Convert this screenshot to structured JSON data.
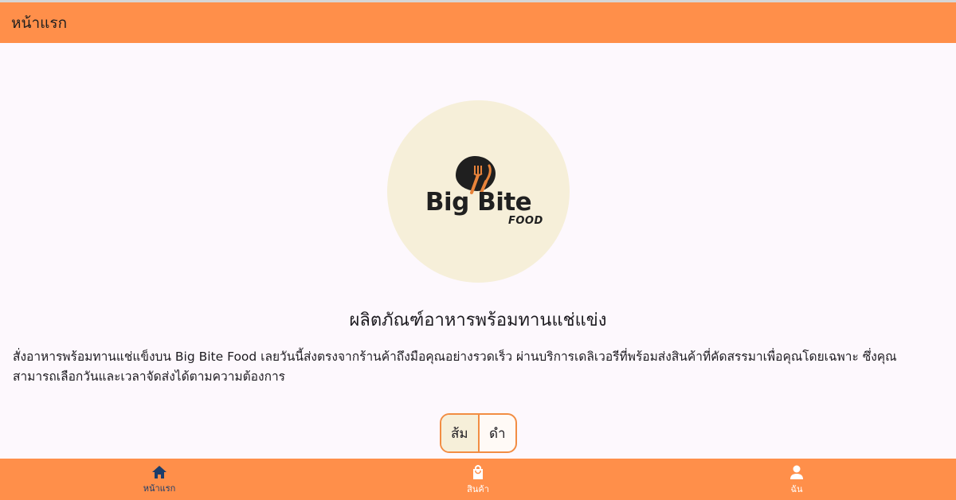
{
  "appbar": {
    "title": "หน้าแรก"
  },
  "logo": {
    "brand": "Big Bite",
    "sub": "FOOD",
    "circle_color": "#f6efd9"
  },
  "content": {
    "headline": "ผลิตภัณฑ์อาหารพร้อมทานแช่แข่ง",
    "description": "  สั่งอาหารพร้อมทานแช่แข็งบน Big Bite Food เลยวันนี้ส่งตรงจากร้านค้าถึงมือคุณอย่างรวดเร็ว ผ่านบริการเดลิเวอรีที่พร้อมส่งสินค้าที่คัดสรรมาเพื่อคุณโดยเฉพาะ ซึ่งคุณสามารถเลือกวันและเวลาจัดส่งได้ตามความต้องการ"
  },
  "theme_toggle": {
    "options": [
      "ส้ม",
      "ดำ"
    ],
    "selected": "ส้ม"
  },
  "bottom_nav": {
    "items": [
      {
        "label": "หน้าแรก",
        "icon": "home-icon",
        "active": true
      },
      {
        "label": "สินค้า",
        "icon": "shopping-bag-icon",
        "active": false
      },
      {
        "label": "ฉัน",
        "icon": "person-icon",
        "active": false
      }
    ]
  },
  "colors": {
    "primary": "#ff8f4a",
    "background": "#fdf8fd",
    "active_nav": "#1c3d6b"
  }
}
